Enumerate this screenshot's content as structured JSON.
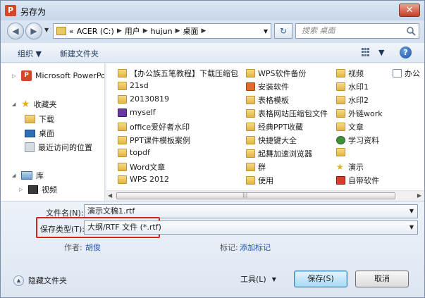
{
  "window": {
    "title": "另存为",
    "app_icon": "P",
    "close_label": "✕"
  },
  "address": {
    "crumbs": [
      "«",
      "ACER (C:)",
      "用户",
      "hujun",
      "桌面"
    ],
    "search_placeholder": "搜索 桌面"
  },
  "toolbar": {
    "organize": "组织 ▼",
    "new_folder": "新建文件夹"
  },
  "nav": {
    "items": [
      {
        "label": "Microsoft PowerPoint",
        "icon": "ppt-icon"
      },
      {
        "label": "收藏夹",
        "icon": "star-icon"
      },
      {
        "label": "下载",
        "icon": "folder-icon"
      },
      {
        "label": "桌面",
        "icon": "desktop-icon"
      },
      {
        "label": "最近访问的位置",
        "icon": "recent-places-icon"
      },
      {
        "label": "库",
        "icon": "library-icon"
      },
      {
        "label": "视频",
        "icon": "video-icon"
      }
    ]
  },
  "files": {
    "col1": [
      "【办公族五笔教程】下载压缩包",
      "21sd",
      "20130819",
      "myself",
      "office爱好者水印",
      "PPT课件模板案例",
      "topdf",
      "Word文章",
      "WPS 2012"
    ],
    "col2": [
      "WPS软件备份",
      "安装软件",
      "表格模板",
      "表格网站压缩包文件",
      "经典PPT收藏",
      "快捷键大全",
      "起舞加速浏览器",
      "群",
      "使用"
    ],
    "col3": [
      "视频",
      "水印1",
      "水印2",
      "外链work",
      "文章",
      "学习资料",
      "",
      "演示",
      "自带软件"
    ],
    "col4": [
      "办公"
    ]
  },
  "form": {
    "filename_label": "文件名(N):",
    "filename_value": "演示文稿1.rtf",
    "savetype_label": "保存类型(T):",
    "savetype_value": "大纲/RTF 文件 (*.rtf)",
    "author_label": "作者:",
    "author_value": "胡俊",
    "tags_label": "标记:",
    "tags_value": "添加标记"
  },
  "footer": {
    "hide_folders": "隐藏文件夹",
    "tools": "工具(L)",
    "save": "保存(S)",
    "cancel": "取消"
  },
  "colors": {
    "highlight_box": "#d8221d",
    "link": "#2855b5",
    "primary_button": "#a7d9f5"
  }
}
